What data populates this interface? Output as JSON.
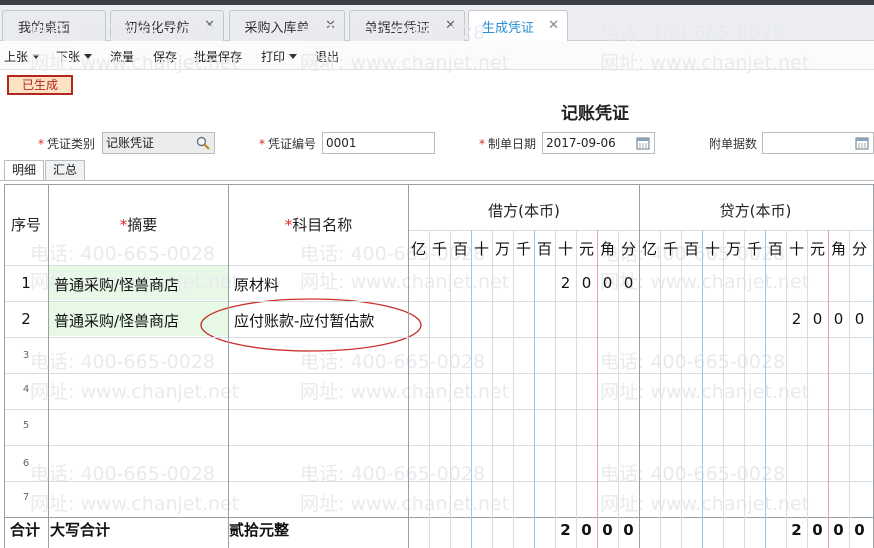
{
  "tabs": [
    {
      "label": "我的桌面",
      "active": false
    },
    {
      "label": "初始化导航",
      "active": false
    },
    {
      "label": "采购入库单",
      "active": false
    },
    {
      "label": "单据生凭证",
      "active": false
    },
    {
      "label": "生成凭证",
      "active": true
    }
  ],
  "toolbar": {
    "prev": "上张",
    "next": "下张",
    "flow": "流量",
    "save": "保存",
    "batch_save": "批量保存",
    "print": "打印",
    "exit": "退出"
  },
  "status_badge": "已生成",
  "voucher_title": "记账凭证",
  "form": {
    "category_label": "凭证类别",
    "category_value": "记账凭证",
    "number_label": "凭证编号",
    "number_value": "0001",
    "date_label": "制单日期",
    "date_value": "2017-09-06",
    "attach_label": "附单据数",
    "attach_value": ""
  },
  "subtabs": [
    "明细",
    "汇总"
  ],
  "grid": {
    "headers": {
      "seq": "序号",
      "summary": "摘要",
      "account": "科目名称",
      "debit": "借方(本币)",
      "credit": "贷方(本币)"
    },
    "units": [
      "亿",
      "千",
      "百",
      "十",
      "万",
      "千",
      "百",
      "十",
      "元",
      "角",
      "分"
    ],
    "rows": [
      {
        "no": "1",
        "summary": "普通采购/怪兽商店",
        "account": "原材料",
        "debit_digits": [
          "2",
          "0",
          "0",
          "0"
        ],
        "credit_digits": []
      },
      {
        "no": "2",
        "summary": "普通采购/怪兽商店",
        "account": "应付账款-应付暂估款",
        "debit_digits": [],
        "credit_digits": [
          "2",
          "0",
          "0",
          "0"
        ]
      },
      {
        "no": "3"
      },
      {
        "no": "4"
      },
      {
        "no": "5"
      },
      {
        "no": "6"
      },
      {
        "no": "7"
      }
    ],
    "total": {
      "label": "合计",
      "caps_label": "大写合计",
      "caps_value": "贰拾元整",
      "debit_digits": [
        "2",
        "0",
        "0",
        "0"
      ],
      "credit_digits": [
        "2",
        "0",
        "0",
        "0"
      ]
    }
  },
  "watermark": {
    "phone": "电话: 400-665-0028",
    "site": "网址: www.chanjet.net"
  },
  "colors": {
    "accent": "#2a8fd6",
    "status_border": "#b2261d",
    "status_bg": "#fde3c4",
    "summary_bg": "#e7f9e6",
    "required": "#d92b1d"
  }
}
